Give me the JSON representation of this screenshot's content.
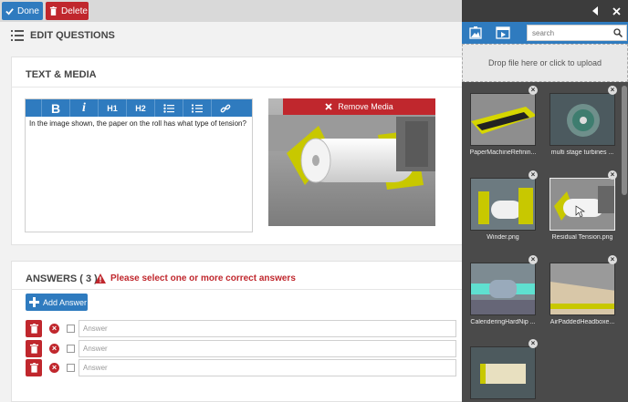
{
  "toolbar": {
    "done_label": "Done",
    "delete_label": "Delete"
  },
  "header": {
    "title": "EDIT QUESTIONS"
  },
  "text_media": {
    "title": "TEXT & MEDIA",
    "editor_buttons": [
      "B",
      "i",
      "H1",
      "H2",
      "ul",
      "ol",
      "link"
    ],
    "editor_text": "In the image shown, the paper on the roll has what type of tension?",
    "remove_media_label": "Remove Media"
  },
  "answers": {
    "title": "ANSWERS ( 3 )",
    "warning": "Please select one or more correct answers",
    "add_label": "Add Answer",
    "placeholder": "Answer",
    "rows": [
      {
        "value": ""
      },
      {
        "value": ""
      },
      {
        "value": ""
      }
    ]
  },
  "drawer": {
    "search_placeholder": "search",
    "drop_text": "Drop file here or click to upload",
    "thumbnails": [
      {
        "label": "PaperMachineRefinin..."
      },
      {
        "label": "multi stage turbines ..."
      },
      {
        "label": "Winder.png"
      },
      {
        "label": "Residual Tension.png"
      },
      {
        "label": "CalenderingHardNip ..."
      },
      {
        "label": "AirPaddedHeadboxe..."
      },
      {
        "label": ""
      }
    ]
  },
  "colors": {
    "accent": "#2f7bbf",
    "danger": "#c0272d"
  }
}
